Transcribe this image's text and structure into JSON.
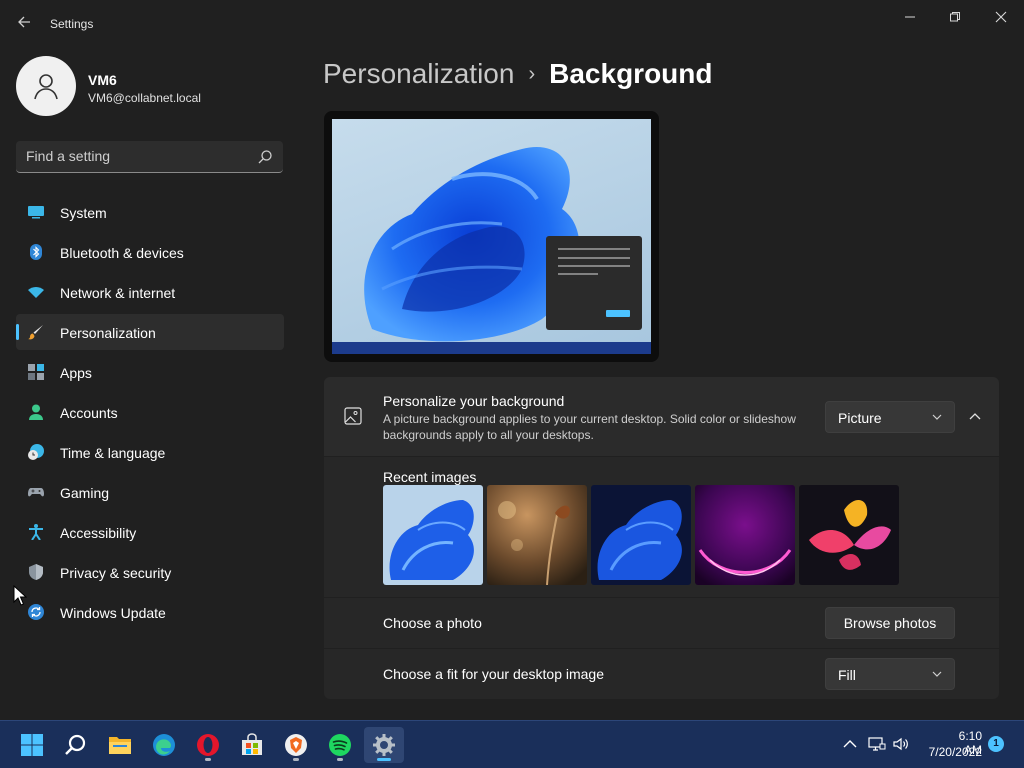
{
  "window": {
    "title": "Settings"
  },
  "user": {
    "name": "VM6",
    "email": "VM6@collabnet.local"
  },
  "search": {
    "placeholder": "Find a setting"
  },
  "sidebar": {
    "selected": "Personalization",
    "items": [
      {
        "label": "System",
        "icon": "system-icon"
      },
      {
        "label": "Bluetooth & devices",
        "icon": "bluetooth-icon"
      },
      {
        "label": "Network & internet",
        "icon": "wifi-icon"
      },
      {
        "label": "Personalization",
        "icon": "brush-icon"
      },
      {
        "label": "Apps",
        "icon": "apps-icon"
      },
      {
        "label": "Accounts",
        "icon": "person-icon"
      },
      {
        "label": "Time & language",
        "icon": "clock-globe-icon"
      },
      {
        "label": "Gaming",
        "icon": "gamepad-icon"
      },
      {
        "label": "Accessibility",
        "icon": "accessibility-icon"
      },
      {
        "label": "Privacy & security",
        "icon": "shield-icon"
      },
      {
        "label": "Windows Update",
        "icon": "update-icon"
      }
    ]
  },
  "breadcrumb": {
    "parent": "Personalization",
    "separator": "›",
    "current": "Background"
  },
  "background": {
    "title": "Personalize your background",
    "description": "A picture background applies to your current desktop. Solid color or slideshow backgrounds apply to all your desktops.",
    "type_value": "Picture",
    "recent_label": "Recent images",
    "recent_images": [
      "bloom-blue-light",
      "butterfly-bokeh",
      "bloom-blue-dark",
      "purple-arc",
      "flower-abstract"
    ],
    "choose_photo_label": "Choose a photo",
    "browse_label": "Browse photos",
    "fit_label": "Choose a fit for your desktop image",
    "fit_value": "Fill"
  },
  "taskbar": {
    "apps": [
      "start-icon",
      "search-icon",
      "file-explorer-icon",
      "edge-icon",
      "opera-icon",
      "store-icon",
      "brave-icon",
      "spotify-icon",
      "settings-icon"
    ],
    "active_app": "settings-icon",
    "time": "6:10 AM",
    "date": "7/20/2022",
    "notification_count": "1"
  },
  "colors": {
    "accent": "#4cc2ff",
    "background": "#202020",
    "card": "#2b2b2b",
    "taskbar": "#1a2f5a"
  }
}
